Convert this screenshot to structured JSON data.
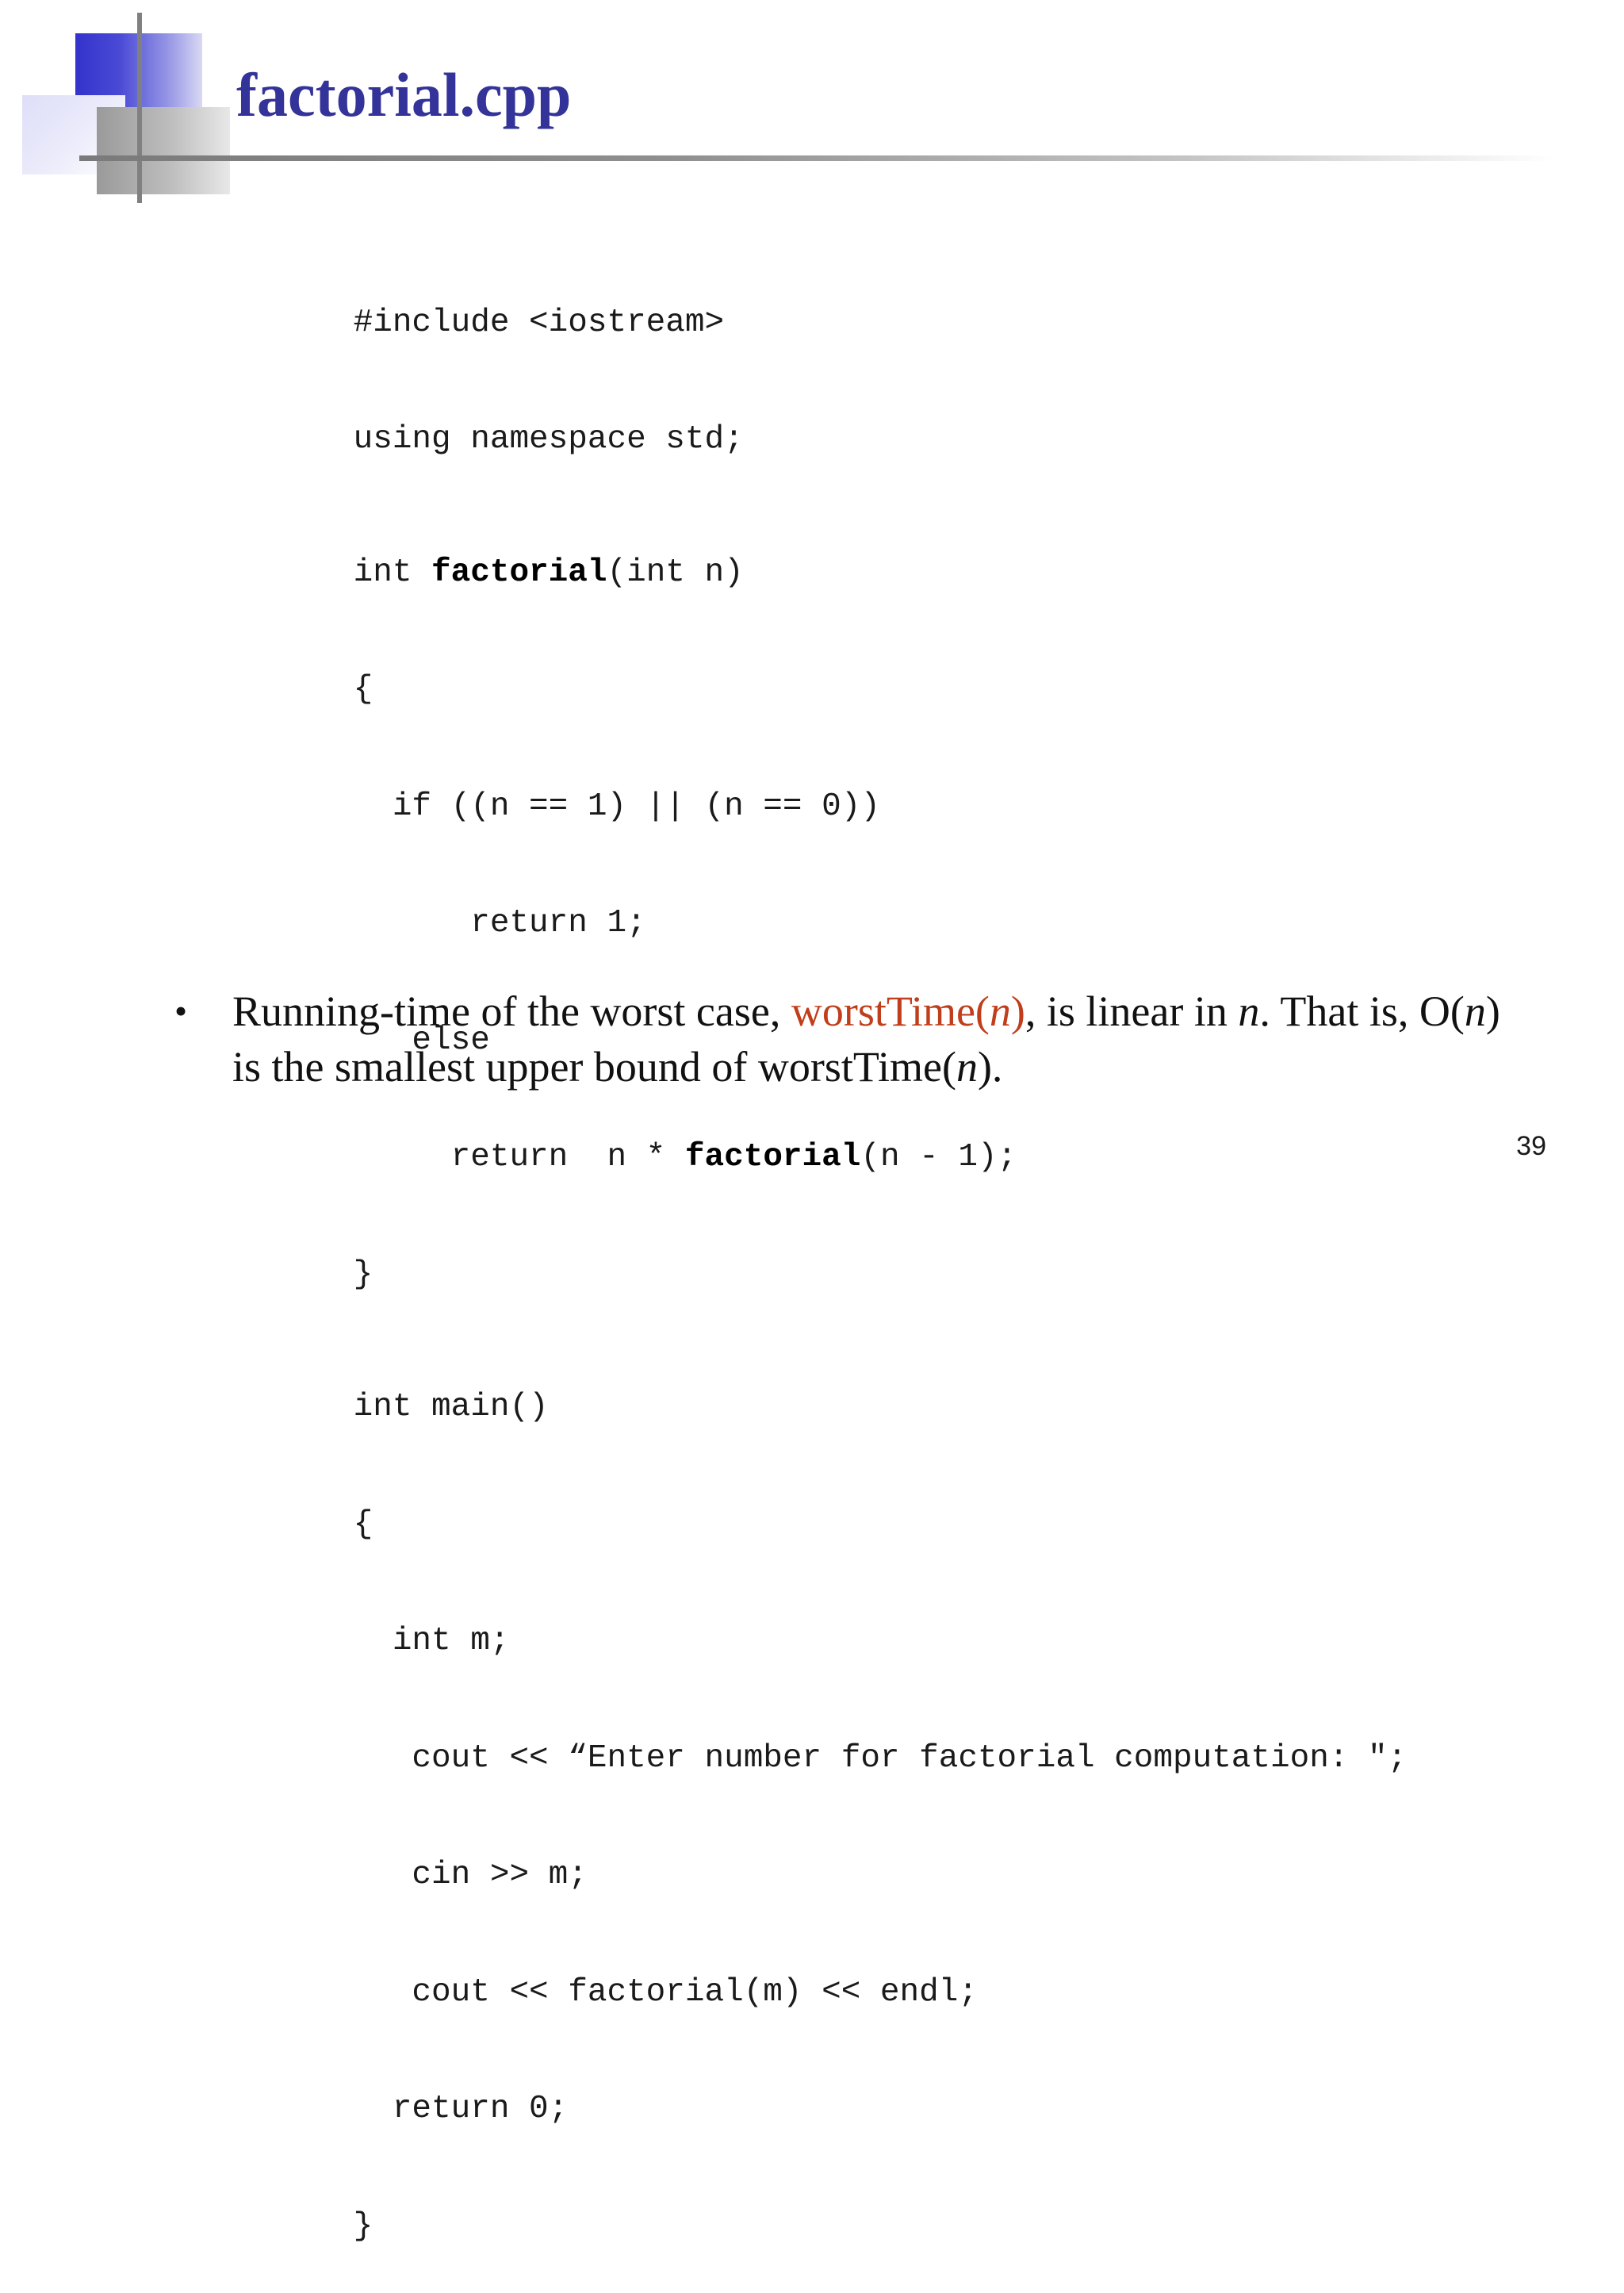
{
  "slide": {
    "title": "factorial.cpp",
    "page_number": "39",
    "colors": {
      "title": "#333399",
      "accent": "#c03e1b",
      "text": "#111111"
    },
    "decoration": [
      "blue-square",
      "pale-square",
      "grey-square",
      "vertical-rule",
      "horizontal-rule"
    ]
  },
  "code": {
    "lines": [
      {
        "parts": [
          {
            "text": "#include <iostream>"
          }
        ]
      },
      {
        "parts": [
          {
            "text": "using namespace std;"
          }
        ]
      },
      {
        "parts": [
          {
            "text": "int "
          },
          {
            "text": "factorial",
            "bold": true
          },
          {
            "text": "(int n)"
          }
        ]
      },
      {
        "parts": [
          {
            "text": "{"
          }
        ]
      },
      {
        "parts": [
          {
            "text": "  if ((n == 1) || (n == 0))"
          }
        ]
      },
      {
        "parts": [
          {
            "text": "      return 1;"
          }
        ]
      },
      {
        "parts": [
          {
            "text": "   else"
          }
        ]
      },
      {
        "parts": [
          {
            "text": "     return  n * "
          },
          {
            "text": "factorial",
            "bold": true
          },
          {
            "text": "(n - 1);"
          }
        ]
      },
      {
        "parts": [
          {
            "text": "}"
          }
        ]
      },
      {
        "parts": [
          {
            "text": "int main()"
          }
        ]
      },
      {
        "parts": [
          {
            "text": "{"
          }
        ]
      },
      {
        "parts": [
          {
            "text": "  int m;"
          }
        ]
      },
      {
        "parts": [
          {
            "text": "   cout << “Enter number for factorial computation: \";"
          }
        ]
      },
      {
        "parts": [
          {
            "text": "   cin >> m;"
          }
        ]
      },
      {
        "parts": [
          {
            "text": "   cout << factorial(m) << endl;"
          }
        ]
      },
      {
        "parts": [
          {
            "text": "  return 0;"
          }
        ]
      },
      {
        "parts": [
          {
            "text": "}"
          }
        ]
      }
    ]
  },
  "bullet": {
    "marker": "•",
    "parts": [
      {
        "text": "Running-time of the worst case, "
      },
      {
        "text": "worstTime(",
        "accent": true
      },
      {
        "text": "n",
        "accent": true,
        "italic": true
      },
      {
        "text": ")",
        "accent": true
      },
      {
        "text": ", is linear in "
      },
      {
        "text": "n",
        "italic": true
      },
      {
        "text": ". That is, O("
      },
      {
        "text": "n",
        "italic": true
      },
      {
        "text": ") is the smallest upper bound of worstTime("
      },
      {
        "text": "n",
        "italic": true
      },
      {
        "text": ")."
      }
    ]
  }
}
